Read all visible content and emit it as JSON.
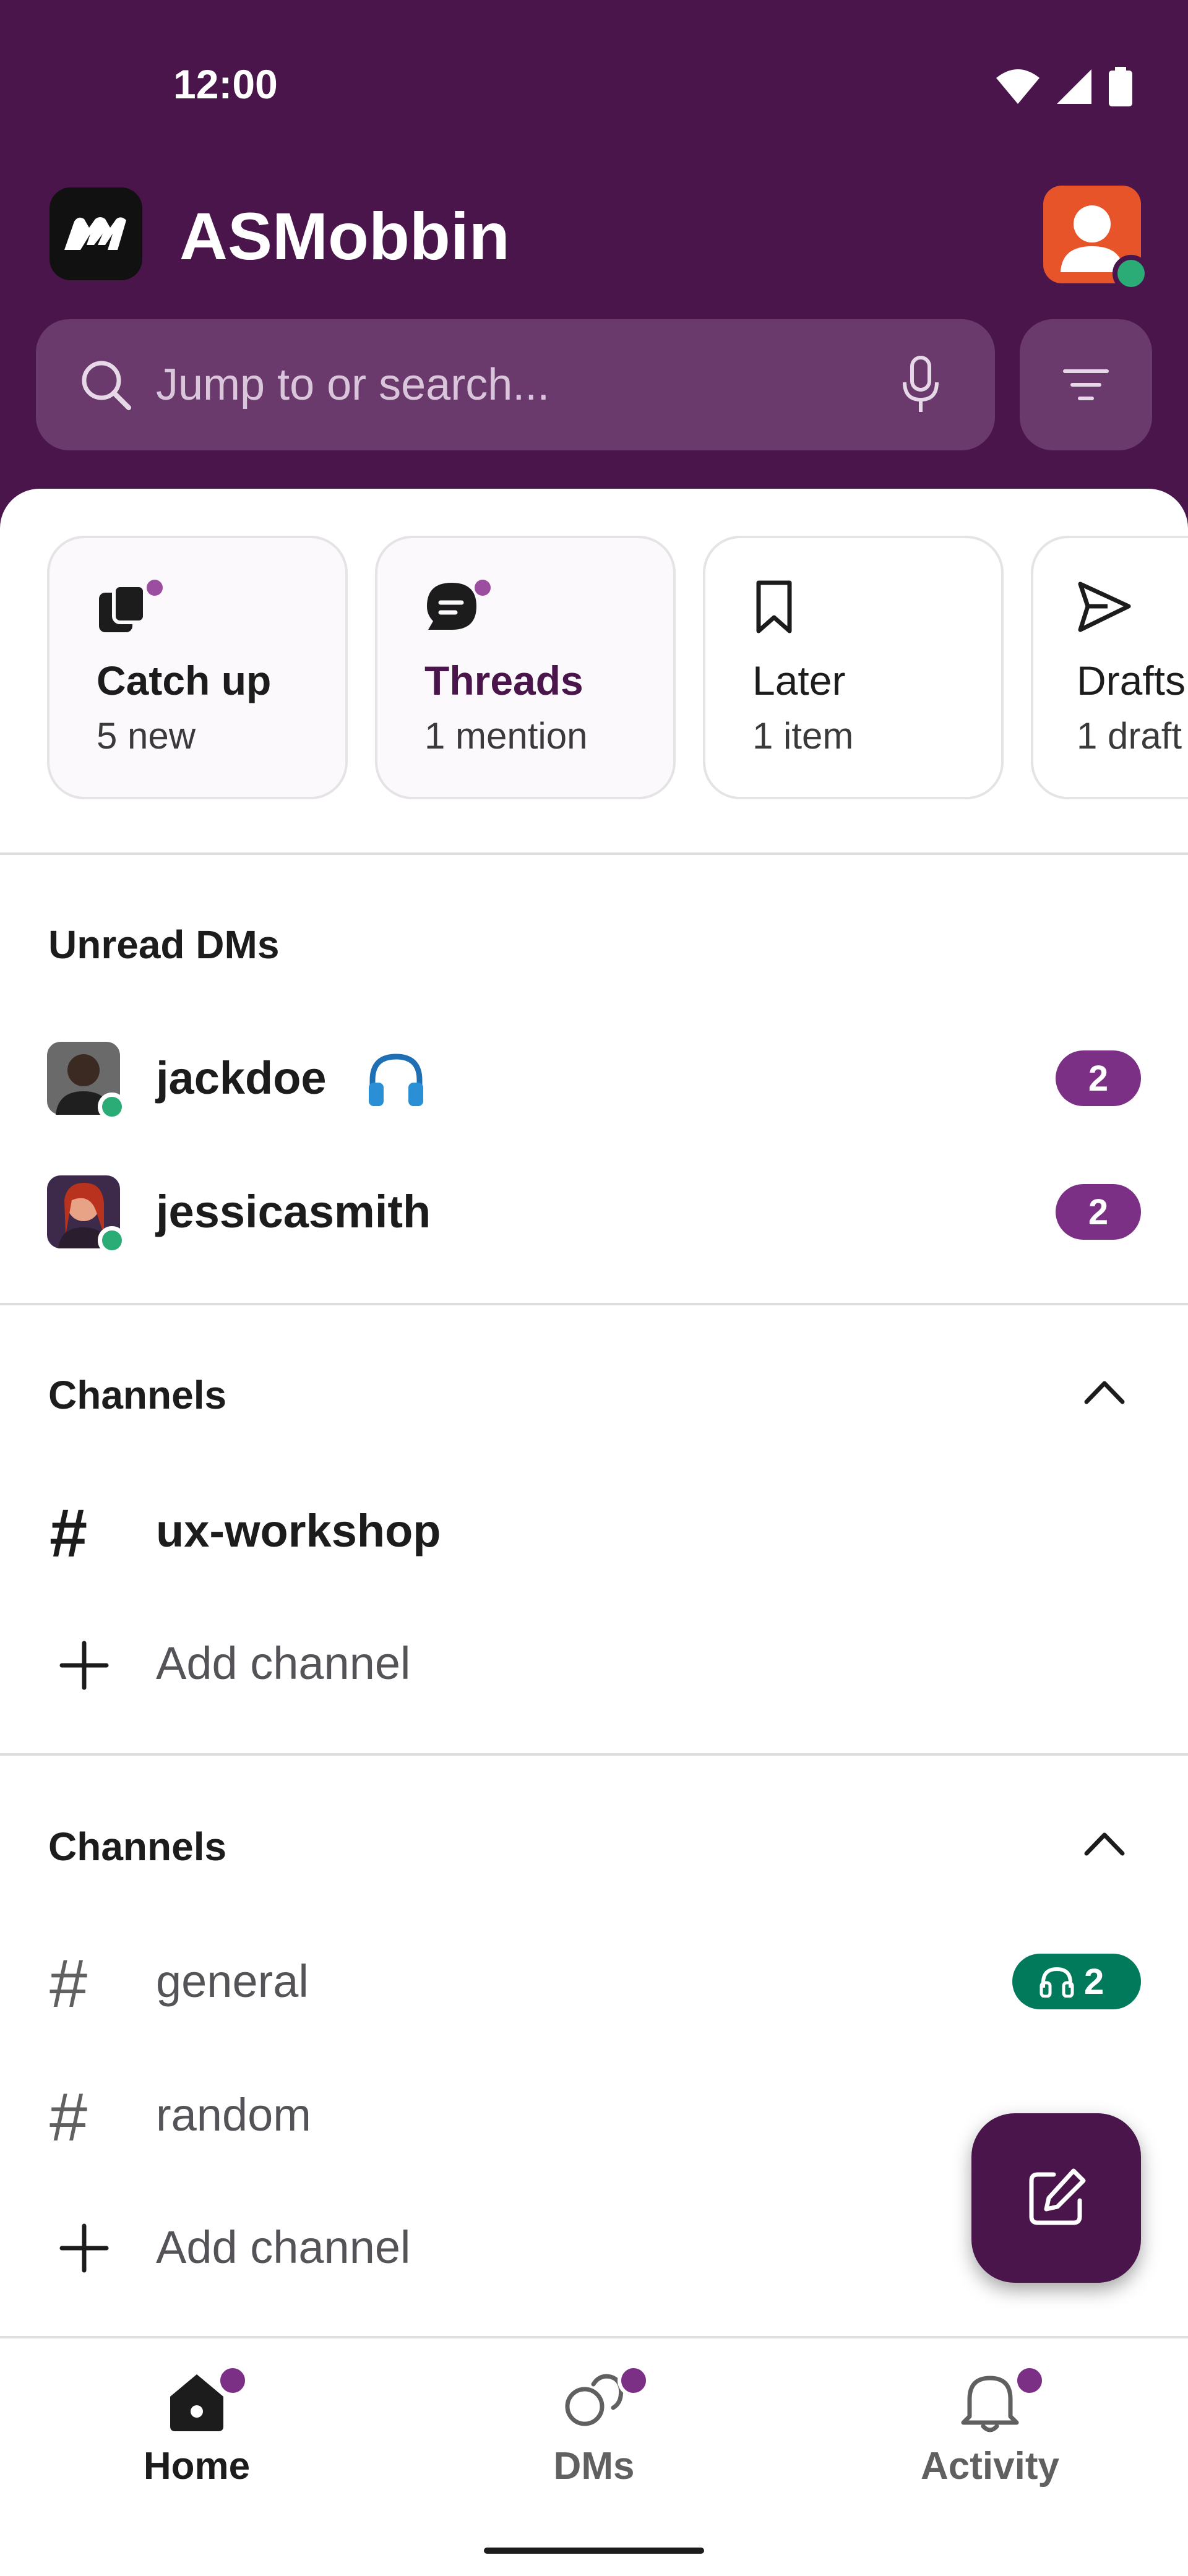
{
  "status_bar": {
    "time": "12:00"
  },
  "workspace": {
    "name": "ASMobbin"
  },
  "search": {
    "placeholder": "Jump to or search..."
  },
  "cards": [
    {
      "title": "Catch up",
      "sub": "5 new",
      "icon": "catch-up-icon"
    },
    {
      "title": "Threads",
      "sub": "1 mention",
      "icon": "threads-icon"
    },
    {
      "title": "Later",
      "sub": "1 item",
      "icon": "bookmark-icon"
    },
    {
      "title": "Drafts",
      "sub": "1 draft",
      "icon": "send-icon"
    }
  ],
  "unread_dms": {
    "title": "Unread DMs",
    "items": [
      {
        "name": "jackdoe",
        "status_icon": "headphones-icon",
        "badge": "2"
      },
      {
        "name": "jessicasmith",
        "badge": "2"
      }
    ]
  },
  "channels_1": {
    "title": "Channels",
    "items": [
      {
        "name": "ux-workshop"
      }
    ],
    "add_label": "Add channel"
  },
  "channels_2": {
    "title": "Channels",
    "items": [
      {
        "name": "general",
        "badge": "2",
        "badge_icon": "headphones-icon"
      },
      {
        "name": "random"
      }
    ],
    "add_label": "Add channel"
  },
  "nav": {
    "home": "Home",
    "dms": "DMs",
    "activity": "Activity"
  },
  "colors": {
    "brand": "#4a154b",
    "badge": "#7c3085",
    "online": "#2bac76",
    "huddle": "#007a5a"
  }
}
